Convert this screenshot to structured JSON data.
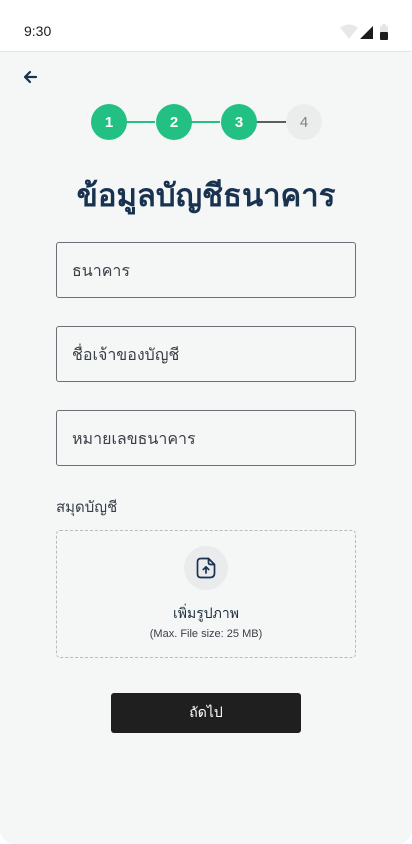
{
  "status_bar": {
    "time": "9:30",
    "icons": [
      "wifi-icon",
      "cellular-signal-icon",
      "battery-icon"
    ]
  },
  "header": {
    "back_icon": "arrow-left-icon"
  },
  "stepper": {
    "steps": [
      {
        "label": "1",
        "state": "done"
      },
      {
        "label": "2",
        "state": "done"
      },
      {
        "label": "3",
        "state": "done"
      },
      {
        "label": "4",
        "state": "todo"
      }
    ],
    "current_step": 3
  },
  "page_title": "ข้อมูลบัญชีธนาคาร",
  "form": {
    "bank_placeholder": "ธนาคาร",
    "bank_value": "",
    "account_name_placeholder": "ชื่อเจ้าของบัญชี",
    "account_name_value": "",
    "account_number_placeholder": "หมายเลขธนาคาร",
    "account_number_value": ""
  },
  "upload": {
    "label": "สมุดบัญชี",
    "title": "เพิ่มรูปภาพ",
    "hint": "(Max. File size: 25 MB)",
    "icon": "file-upload-icon"
  },
  "actions": {
    "next_label": "ถัดไป"
  },
  "colors": {
    "accent": "#22c083",
    "title": "#18324f",
    "button": "#1f1f1f",
    "background": "#f5f7f7"
  }
}
